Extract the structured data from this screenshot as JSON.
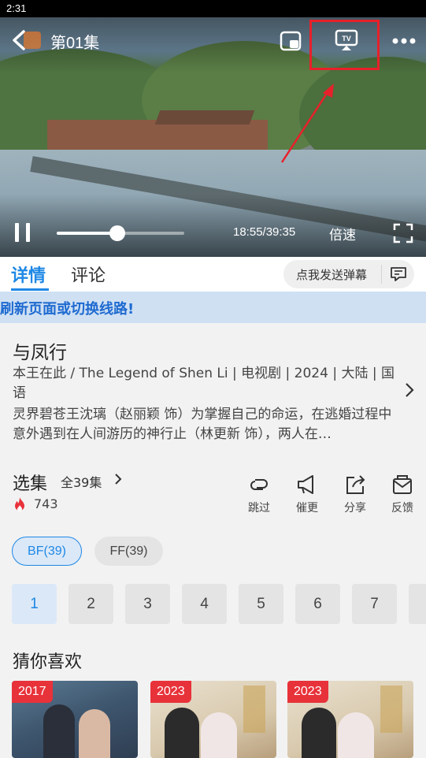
{
  "status_bar": {
    "time": "2:31"
  },
  "player": {
    "episode_title": "第01集",
    "time_display": "18:55/39:35",
    "speed_label": "倍速",
    "progress_fraction": 0.478
  },
  "tabs": {
    "details": "详情",
    "comments": "评论"
  },
  "danmaku": {
    "label": "点我发送弹幕"
  },
  "notice": {
    "text": "刷新页面或切换线路!"
  },
  "show": {
    "title": "与凤行",
    "meta": "本王在此 / The Legend of Shen Li | 电视剧 | 2024 | 大陆 | 国语",
    "synopsis": "灵界碧苍王沈璃（赵丽颖 饰）为掌握自己的命运，在逃婚过程中意外遇到在人间游历的神行止（林更新 饰），两人在…"
  },
  "episodes": {
    "title": "选集",
    "total": "全39集",
    "heat": "743",
    "actions": [
      {
        "label": "跳过",
        "icon": "skip-icon"
      },
      {
        "label": "催更",
        "icon": "megaphone-icon"
      },
      {
        "label": "分享",
        "icon": "share-icon"
      },
      {
        "label": "反馈",
        "icon": "feedback-icon"
      }
    ],
    "sources": [
      {
        "label": "BF(39)"
      },
      {
        "label": "FF(39)"
      }
    ],
    "list": [
      "1",
      "2",
      "3",
      "4",
      "5",
      "6",
      "7"
    ],
    "selected": "1"
  },
  "recommend": {
    "title": "猜你喜欢",
    "items": [
      {
        "year": "2017"
      },
      {
        "year": "2023"
      },
      {
        "year": "2023"
      }
    ]
  },
  "colors": {
    "accent": "#1e88e5",
    "badge": "#e8323a",
    "highlight": "#e8202a"
  }
}
